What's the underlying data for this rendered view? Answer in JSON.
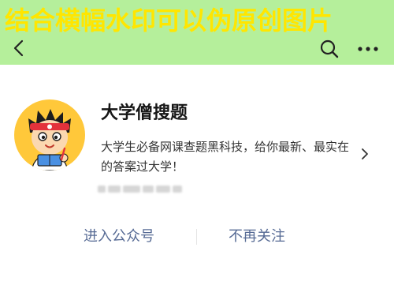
{
  "watermark": {
    "text": "结合横幅水印可以伪原创图片"
  },
  "nav": {
    "back_icon": "chevron-left-icon",
    "search_icon": "search-icon",
    "more_icon": "more-dots-icon"
  },
  "account": {
    "name": "大学僧搜题",
    "description": "大学生必备网课查题黑科技，给你最新、最实在的答案过大学！",
    "avatar_icon": "cartoon-student-avatar-icon",
    "detail_icon": "chevron-right-icon"
  },
  "actions": {
    "enter_label": "进入公众号",
    "unfollow_label": "不再关注"
  },
  "colors": {
    "banner_background": "#b5ef9b",
    "watermark_text": "#ffe600",
    "avatar_background": "#ffc83a",
    "action_text": "#576b95"
  }
}
